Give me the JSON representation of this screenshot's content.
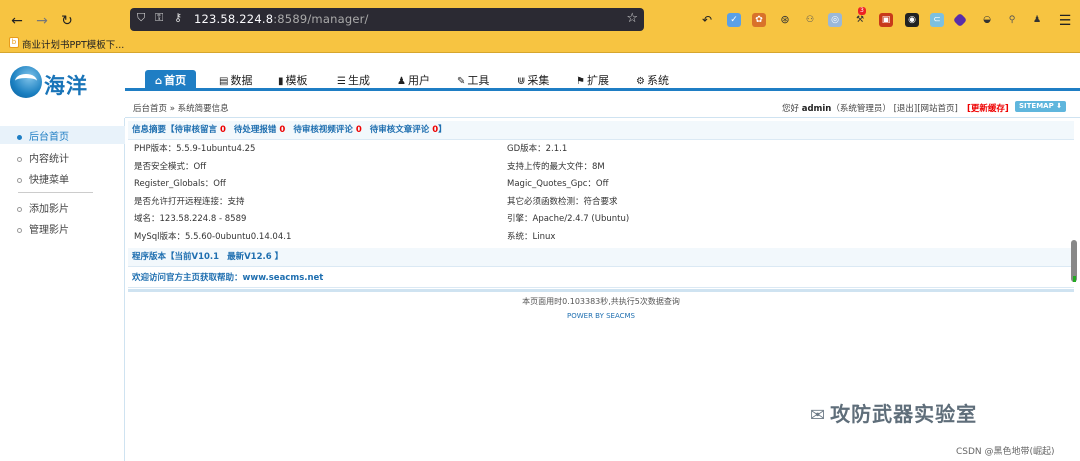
{
  "browser": {
    "back": "←",
    "forward": "→",
    "reload": "↻",
    "url": "123.58.224.8:8589/manager/",
    "url_host": "123.58.224.8",
    "url_rest": ":8589/manager/",
    "bookmark_label": "商业计划书PPT模板下...",
    "extension_badge": "3",
    "menu": "☰"
  },
  "logo": {
    "text": "海洋"
  },
  "nav": {
    "tabs": [
      {
        "icon": "⌂",
        "label": "首页"
      },
      {
        "icon": "▤",
        "label": "数据"
      },
      {
        "icon": "▮",
        "label": "模板"
      },
      {
        "icon": "☰",
        "label": "生成"
      },
      {
        "icon": "♟",
        "label": "用户"
      },
      {
        "icon": "✎",
        "label": "工具"
      },
      {
        "icon": "⋓",
        "label": "采集"
      },
      {
        "icon": "⚑",
        "label": "扩展"
      },
      {
        "icon": "⚙",
        "label": "系统"
      }
    ]
  },
  "breadcrumb": {
    "home": "后台首页",
    "sep": "»",
    "current": "系统简要信息"
  },
  "user": {
    "greeting": "您好",
    "name": "admin",
    "role": "（系统管理员）",
    "logout": "[退出]",
    "site_home": "[网站首页]",
    "clear_cache": "[更新缓存]",
    "sitemap": "SITEMAP ⬇"
  },
  "sidebar": {
    "items": [
      {
        "label": "后台首页"
      },
      {
        "label": "内容统计"
      },
      {
        "label": "快捷菜单"
      },
      {
        "label": "添加影片"
      },
      {
        "label": "管理影片"
      }
    ]
  },
  "summary": {
    "title": "信息摘要【",
    "links": [
      {
        "label": "待审核留言",
        "count": "0"
      },
      {
        "label": "待处理报错",
        "count": "0"
      },
      {
        "label": "待审核视频评论",
        "count": "0"
      },
      {
        "label": "待审核文章评论",
        "count": "0"
      }
    ],
    "close": "】"
  },
  "info": {
    "rows": [
      {
        "left": "PHP版本：5.5.9-1ubuntu4.25",
        "right": "GD版本：2.1.1"
      },
      {
        "left": "是否安全模式：Off",
        "right": "支持上传的最大文件：8M"
      },
      {
        "left": "Register_Globals：Off",
        "right": "Magic_Quotes_Gpc：Off"
      },
      {
        "left": "是否允许打开远程连接：支持",
        "right": "其它必须函数检测：符合要求"
      },
      {
        "left": "域名：123.58.224.8 - 8589",
        "right": "引擎：Apache/2.4.7 (Ubuntu)"
      },
      {
        "left": "MySql版本：5.5.60-0ubuntu0.14.04.1",
        "right": "系统：Linux"
      }
    ]
  },
  "version": {
    "label": "程序版本【",
    "current": "当前V10.1",
    "latest": "最新V12.6",
    "close": "】"
  },
  "help": {
    "text": "欢迎访问官方主页获取帮助：www.seacms.net"
  },
  "footer": {
    "time": "本页面用时0.103383秒,共执行5次数据查询",
    "power": "POWER BY SEACMS"
  },
  "watermark": {
    "text": "攻防武器实验室",
    "csdn": "CSDN @黑色地带(崛起)"
  },
  "colors": {
    "accent": "#1f7ec4",
    "browser": "#f7c441",
    "danger": "#e00000"
  }
}
